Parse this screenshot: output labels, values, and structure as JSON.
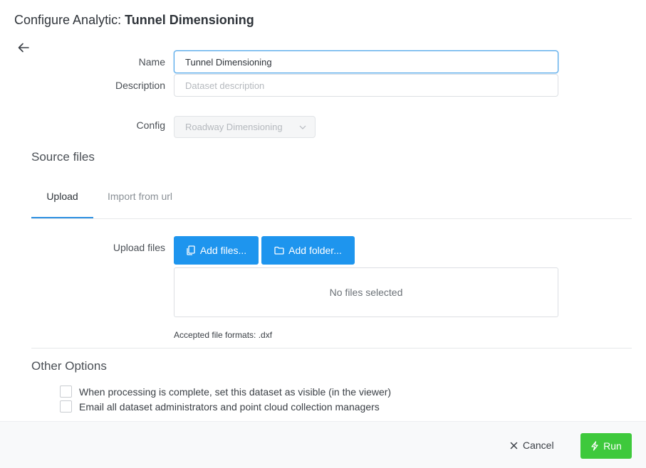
{
  "header": {
    "title_prefix": "Configure Analytic: ",
    "title_name": "Tunnel Dimensioning"
  },
  "form": {
    "name_label": "Name",
    "name_value": "Tunnel Dimensioning",
    "description_label": "Description",
    "description_placeholder": "Dataset description",
    "config_label": "Config",
    "config_value": "Roadway Dimensioning"
  },
  "source_files": {
    "heading": "Source files",
    "tabs": [
      {
        "label": "Upload"
      },
      {
        "label": "Import from url"
      }
    ],
    "upload_label": "Upload files",
    "add_files_label": "Add files...",
    "add_folder_label": "Add folder...",
    "empty_text": "No files selected",
    "accepted_formats": "Accepted file formats: .dxf"
  },
  "other_options": {
    "heading": "Other Options",
    "options": [
      {
        "label": "When processing is complete, set this dataset as visible (in the viewer)"
      },
      {
        "label": "Email all dataset administrators and point cloud collection managers"
      }
    ]
  },
  "footer": {
    "cancel_label": "Cancel",
    "run_label": "Run"
  },
  "colors": {
    "primary": "#1e95ee",
    "run": "#3ec93c",
    "tab_active": "#2b8fe0"
  }
}
